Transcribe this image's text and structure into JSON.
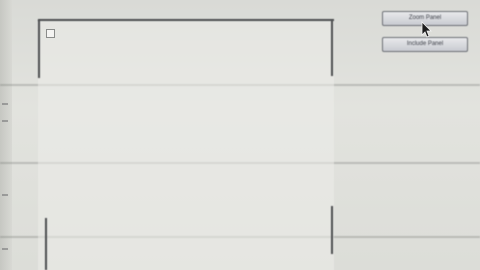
{
  "toolbar": {
    "primary_button_label": "Zoom Panel",
    "secondary_button_label": "Include Panel"
  },
  "panel": {
    "checked": false
  },
  "colors": {
    "background": "#dcddd8",
    "panel_border": "#4c4e50",
    "button_fill": "#d4d6db"
  }
}
